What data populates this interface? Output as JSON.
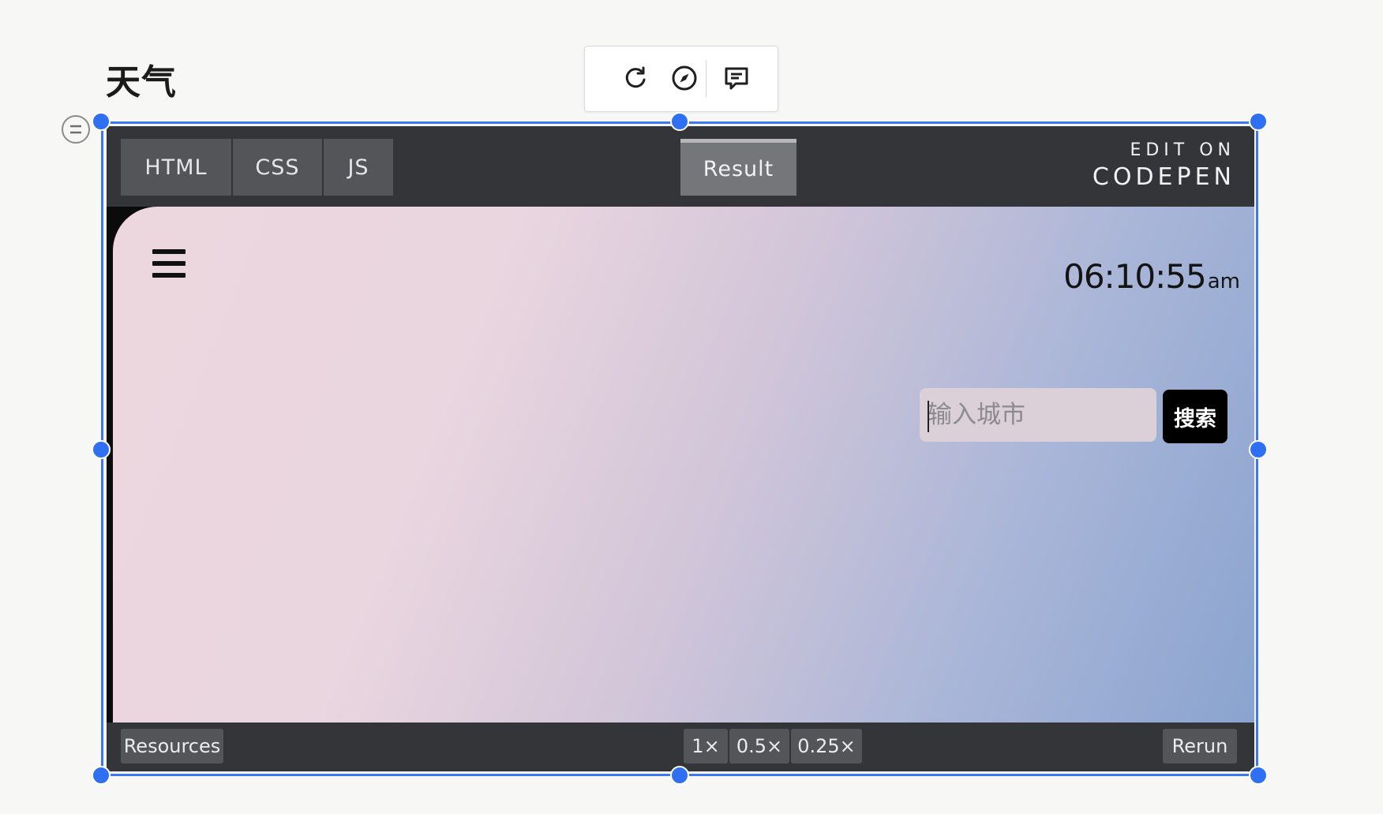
{
  "page": {
    "title": "天气"
  },
  "toolbar": {
    "items": [
      {
        "icon": "refresh-icon",
        "label": "Refresh"
      },
      {
        "icon": "compass-icon",
        "label": "Explore"
      },
      {
        "icon": "comment-icon",
        "label": "Comment"
      }
    ]
  },
  "embed": {
    "tabs": [
      "HTML",
      "CSS",
      "JS"
    ],
    "result_tab": "Result",
    "brand": {
      "line1": "EDIT ON",
      "line2": "CODEPEN"
    },
    "footer": {
      "resources": "Resources",
      "zoom": [
        "1×",
        "0.5×",
        "0.25×"
      ],
      "rerun": "Rerun"
    }
  },
  "app": {
    "menu_icon": "hamburger-menu-icon",
    "clock": {
      "time": "06:10:55",
      "ampm": "am"
    },
    "search": {
      "placeholder": "输入城市",
      "value": "",
      "button": "搜索"
    },
    "gradient_colors": [
      "#ecd7df",
      "#d3c6d9",
      "#8aa4cf"
    ]
  },
  "selection_color": "#2f6ff2"
}
